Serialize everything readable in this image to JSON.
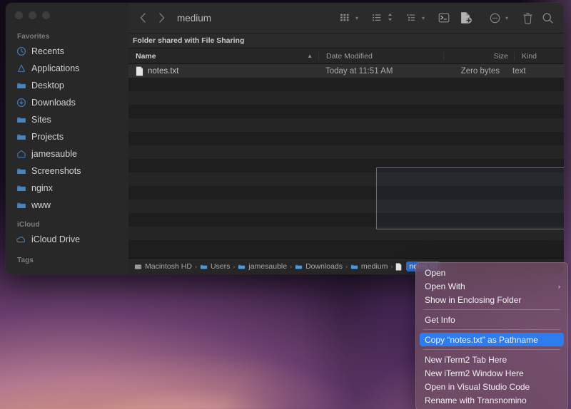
{
  "window": {
    "title": "medium",
    "traffic_lights": [
      "close",
      "minimize",
      "zoom"
    ],
    "shared_banner": "Folder shared with File Sharing"
  },
  "toolbar": {
    "back_icon": "chevron-left-icon",
    "forward_icon": "chevron-right-icon",
    "icon_view_label": "icon-view",
    "list_view_label": "list-view",
    "group_by_label": "group-by",
    "terminal_label": "open-terminal",
    "new_file_label": "new-file",
    "more_label": "more-actions",
    "trash_label": "move-to-trash",
    "search_label": "search"
  },
  "sidebar": {
    "sections": [
      {
        "header": "Favorites",
        "items": [
          {
            "label": "Recents",
            "icon": "clock-icon"
          },
          {
            "label": "Applications",
            "icon": "applications-icon"
          },
          {
            "label": "Desktop",
            "icon": "folder-icon"
          },
          {
            "label": "Downloads",
            "icon": "downloads-icon"
          },
          {
            "label": "Sites",
            "icon": "folder-icon"
          },
          {
            "label": "Projects",
            "icon": "folder-icon"
          },
          {
            "label": "jamesauble",
            "icon": "home-icon"
          },
          {
            "label": "Screenshots",
            "icon": "folder-icon"
          },
          {
            "label": "nginx",
            "icon": "folder-icon"
          },
          {
            "label": "www",
            "icon": "folder-icon"
          }
        ]
      },
      {
        "header": "iCloud",
        "items": [
          {
            "label": "iCloud Drive",
            "icon": "cloud-icon"
          }
        ]
      },
      {
        "header": "Tags",
        "items": []
      }
    ]
  },
  "file_table": {
    "columns": [
      {
        "label": "Name",
        "sorted": true,
        "sort_arrow": "▲"
      },
      {
        "label": "Date Modified"
      },
      {
        "label": "Size"
      },
      {
        "label": "Kind"
      }
    ],
    "rows": [
      {
        "name": "notes.txt",
        "date_modified": "Today at 11:51 AM",
        "size": "Zero bytes",
        "kind": "text",
        "icon": "text-document-icon"
      }
    ],
    "empty_row_count": 13
  },
  "marquee": {
    "label": "drag-selection-rectangle",
    "border_color": "#3b6ee0"
  },
  "path_bar": {
    "crumbs": [
      {
        "label": "Macintosh HD",
        "icon": "harddisk-icon",
        "active": false
      },
      {
        "label": "Users",
        "icon": "folder-icon",
        "active": false
      },
      {
        "label": "jamesauble",
        "icon": "folder-icon",
        "active": false
      },
      {
        "label": "Downloads",
        "icon": "folder-icon",
        "active": false
      },
      {
        "label": "medium",
        "icon": "folder-icon",
        "active": false
      },
      {
        "label": "notes.txt",
        "icon": "text-document-icon",
        "active": true
      }
    ],
    "separator": "›"
  },
  "context_menu": {
    "groups": [
      {
        "items": [
          {
            "label": "Open",
            "submenu": false,
            "highlighted": false
          },
          {
            "label": "Open With",
            "submenu": true,
            "highlighted": false
          },
          {
            "label": "Show in Enclosing Folder",
            "submenu": false,
            "highlighted": false
          }
        ]
      },
      {
        "items": [
          {
            "label": "Get Info",
            "submenu": false,
            "highlighted": false
          }
        ]
      },
      {
        "items": [
          {
            "label": "Copy “notes.txt” as Pathname",
            "submenu": false,
            "highlighted": true
          }
        ]
      },
      {
        "items": [
          {
            "label": "New iTerm2 Tab Here",
            "submenu": false,
            "highlighted": false
          },
          {
            "label": "New iTerm2 Window Here",
            "submenu": false,
            "highlighted": false
          },
          {
            "label": "Open in Visual Studio Code",
            "submenu": false,
            "highlighted": false
          },
          {
            "label": "Rename with Transnomino",
            "submenu": false,
            "highlighted": false
          }
        ]
      }
    ],
    "submenu_arrow": "›",
    "highlight_color": "#2d7df0"
  },
  "colors": {
    "window_bg": "#232323",
    "sidebar_bg": "#282828",
    "main_bg": "#1e1e1e",
    "accent_blue": "#2d7df0",
    "menu_bg": "rgba(112,78,100,0.80)"
  }
}
